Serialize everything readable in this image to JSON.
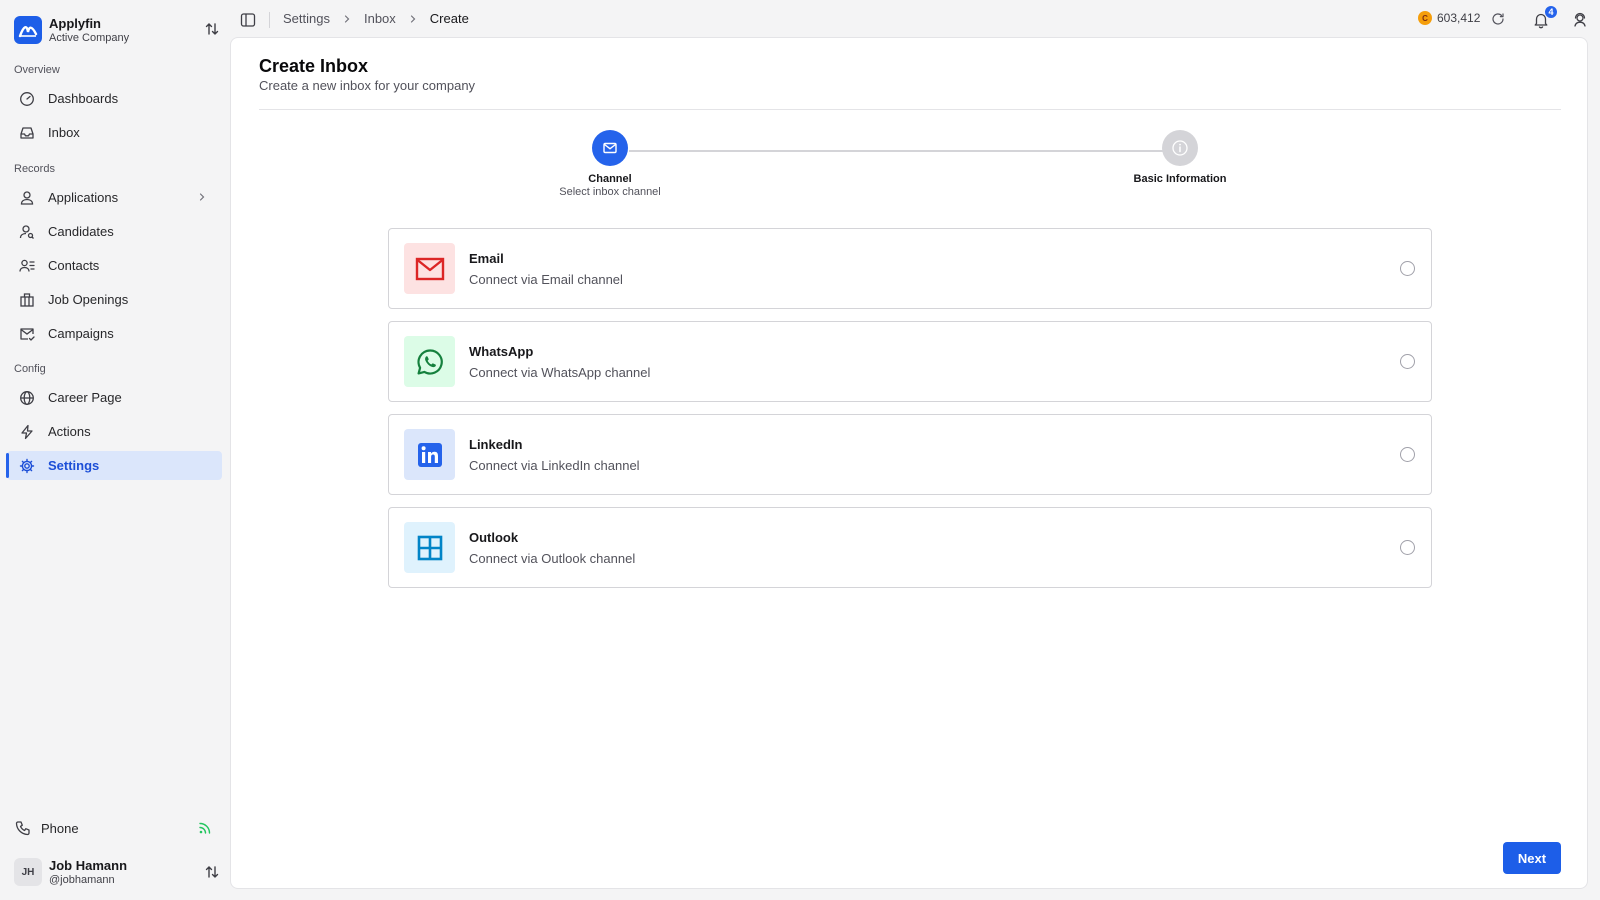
{
  "brand": {
    "name": "Applyfin",
    "subtitle": "Active Company"
  },
  "sidebar": {
    "groups": [
      {
        "label": "Overview"
      },
      {
        "label": "Records"
      },
      {
        "label": "Config"
      }
    ],
    "items": [
      {
        "label": "Dashboards",
        "icon": "gauge-icon"
      },
      {
        "label": "Inbox",
        "icon": "inbox-icon"
      },
      {
        "label": "Applications",
        "icon": "user-icon"
      },
      {
        "label": "Candidates",
        "icon": "user-search-icon"
      },
      {
        "label": "Contacts",
        "icon": "contacts-list-icon"
      },
      {
        "label": "Job Openings",
        "icon": "building-icon"
      },
      {
        "label": "Campaigns",
        "icon": "mail-check-icon"
      },
      {
        "label": "Career Page",
        "icon": "globe-icon"
      },
      {
        "label": "Actions",
        "icon": "zap-icon"
      },
      {
        "label": "Settings",
        "icon": "gear-icon",
        "active": true
      }
    ],
    "phone": {
      "label": "Phone",
      "status_color": "#22c55e"
    },
    "user": {
      "initials": "JH",
      "name": "Job Hamann",
      "handle": "@jobhamann"
    }
  },
  "topbar": {
    "breadcrumb": [
      "Settings",
      "Inbox",
      "Create"
    ],
    "credits": "603,412",
    "notification_count": "4"
  },
  "page": {
    "title": "Create Inbox",
    "subtitle": "Create a new inbox for your company"
  },
  "stepper": {
    "steps": [
      {
        "title": "Channel",
        "subtitle": "Select inbox channel",
        "state": "active"
      },
      {
        "title": "Basic Information",
        "state": "pending"
      }
    ]
  },
  "channels": [
    {
      "name": "Email",
      "description": "Connect via Email channel",
      "icon": "email-icon",
      "color": "#dc2626",
      "bg": "#fde2e2"
    },
    {
      "name": "WhatsApp",
      "description": "Connect via WhatsApp channel",
      "icon": "whatsapp-icon",
      "color": "#16a34a",
      "bg": "#dcfce7"
    },
    {
      "name": "LinkedIn",
      "description": "Connect via LinkedIn channel",
      "icon": "linkedin-icon",
      "color": "#2563eb",
      "bg": "#dbe6fb"
    },
    {
      "name": "Outlook",
      "description": "Connect via Outlook channel",
      "icon": "outlook-icon",
      "color": "#0284c7",
      "bg": "#dff2fd"
    }
  ],
  "actions": {
    "next_label": "Next"
  },
  "colors": {
    "accent": "#1d5ee8",
    "active_nav_bg": "#dbe6fb"
  }
}
